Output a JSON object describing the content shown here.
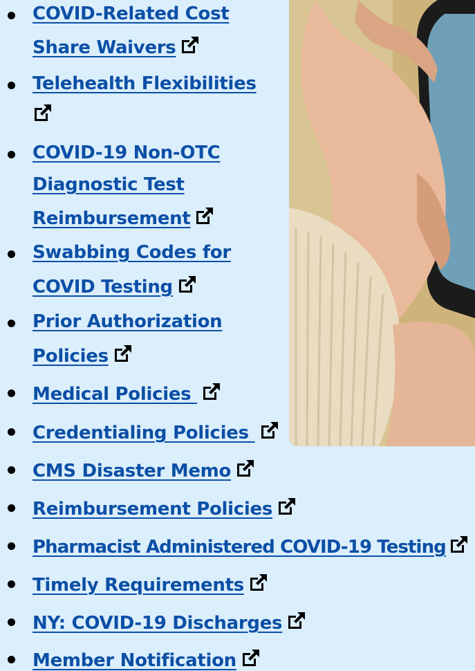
{
  "links": [
    {
      "lines": [
        "COVID-Related Cost",
        "Share Waivers"
      ],
      "external": true
    },
    {
      "lines": [
        "Telehealth Flexibilities",
        ""
      ],
      "external": true
    },
    {
      "lines": [
        "COVID-19 Non-OTC",
        "Diagnostic Test",
        "Reimbursement"
      ],
      "external": true
    },
    {
      "lines": [
        "Swabbing Codes for",
        "COVID Testing"
      ],
      "external": true
    },
    {
      "lines": [
        "Prior Authorization",
        "Policies"
      ],
      "external": true
    },
    {
      "lines": [
        "Medical Policies "
      ],
      "external": true
    },
    {
      "lines": [
        "Credentialing Policies "
      ],
      "external": true
    },
    {
      "lines": [
        "CMS Disaster Memo"
      ],
      "external": true
    },
    {
      "lines": [
        "Reimbursement Policies"
      ],
      "external": true
    },
    {
      "lines": [
        "Pharmacist Administered COVID-19 Testing"
      ],
      "external": true
    },
    {
      "lines": [
        "Timely Requirements"
      ],
      "external": true
    },
    {
      "lines": [
        "NY: COVID-19 Discharges"
      ],
      "external": true
    },
    {
      "lines": [
        "Member Notification"
      ],
      "external": true
    }
  ],
  "icons": {
    "external": "external-link-icon",
    "bullet": "bullet-dot"
  },
  "colors": {
    "background": "#dbeefb",
    "link": "#0b4fa6",
    "bullet": "#000000"
  },
  "image": {
    "description_name": "hand-holding-phone-photo"
  }
}
